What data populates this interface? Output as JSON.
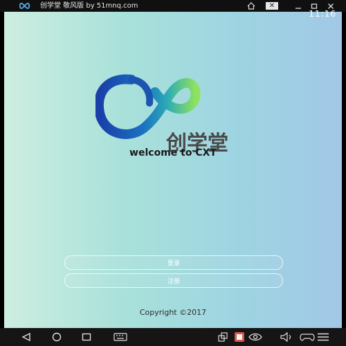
{
  "titlebar": {
    "title": "创学堂 敬风版 by 51mnq.com",
    "controls": [
      "home-icon",
      "close-x-icon",
      "minimize-icon",
      "maximize-icon",
      "close-icon"
    ],
    "close_box_glyph": "✕"
  },
  "status": {
    "time": "11:16"
  },
  "logo": {
    "text": "创学堂",
    "icon": "infinity-icon"
  },
  "welcome": "welcome to CXT",
  "buttons": {
    "login": "登录",
    "register": "注册"
  },
  "copyright": "Copyright ©2017",
  "navbar": {
    "icons": [
      "back-icon",
      "home-circle-icon",
      "recents-icon",
      "keyboard-icon",
      "screen-rotate-icon",
      "app-icon",
      "eye-icon",
      "volume-icon",
      "gamepad-icon",
      "menu-icon"
    ]
  },
  "colors": {
    "accent_blue": "#1e5fb3",
    "accent_green": "#7fd35a",
    "logo_text": "#4a4a4a"
  }
}
